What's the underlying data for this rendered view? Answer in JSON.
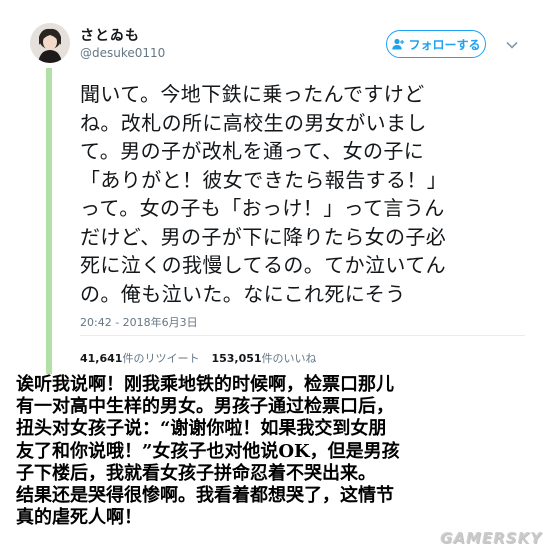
{
  "tweet": {
    "user": {
      "display_name": "さとゐも",
      "handle": "@desuke0110"
    },
    "follow_button_label": "フォローする",
    "text_lines": [
      "聞いて。今地下鉄に乗ったんですけど",
      "ね。改札の所に高校生の男女がいまし",
      "て。男の子が改札を通って、女の子に",
      "「ありがと！彼女できたら報告する！」",
      "って。女の子も「おっけ！」って言うん",
      "だけど、男の子が下に降りたら女の子必",
      "死に泣くの我慢してるの。てか泣いてん",
      "の。俺も泣いた。なにこれ死にそう"
    ],
    "timestamp": "20:42 - 2018年6月3日",
    "stats": {
      "retweets_count": "41,641",
      "retweets_label": "件のリツイート",
      "likes_count": "153,051",
      "likes_label": "件のいいね"
    }
  },
  "translation_lines": [
    "诶听我说啊！刚我乘地铁的时候啊，检票口那儿",
    "有一对高中生样的男女。男孩子通过检票口后，",
    "扭头对女孩子说：“谢谢你啦！如果我交到女朋",
    "友了和你说哦！”女孩子也对他说OK，但是男孩",
    "子下楼后，我就看女孩子拼命忍着不哭出来。",
    "结果还是哭得很惨啊。我看着都想哭了，这情节",
    "真的虐死人啊！"
  ],
  "watermark": "GAMERSKY",
  "colors": {
    "twitter_blue": "#1da1f2",
    "secondary_text": "#657786",
    "primary_text": "#14171a",
    "thread_bar": "#b3e0a6"
  },
  "icons": {
    "follow": "add-user-icon",
    "more": "chevron-down-icon",
    "avatar": "user-avatar"
  }
}
